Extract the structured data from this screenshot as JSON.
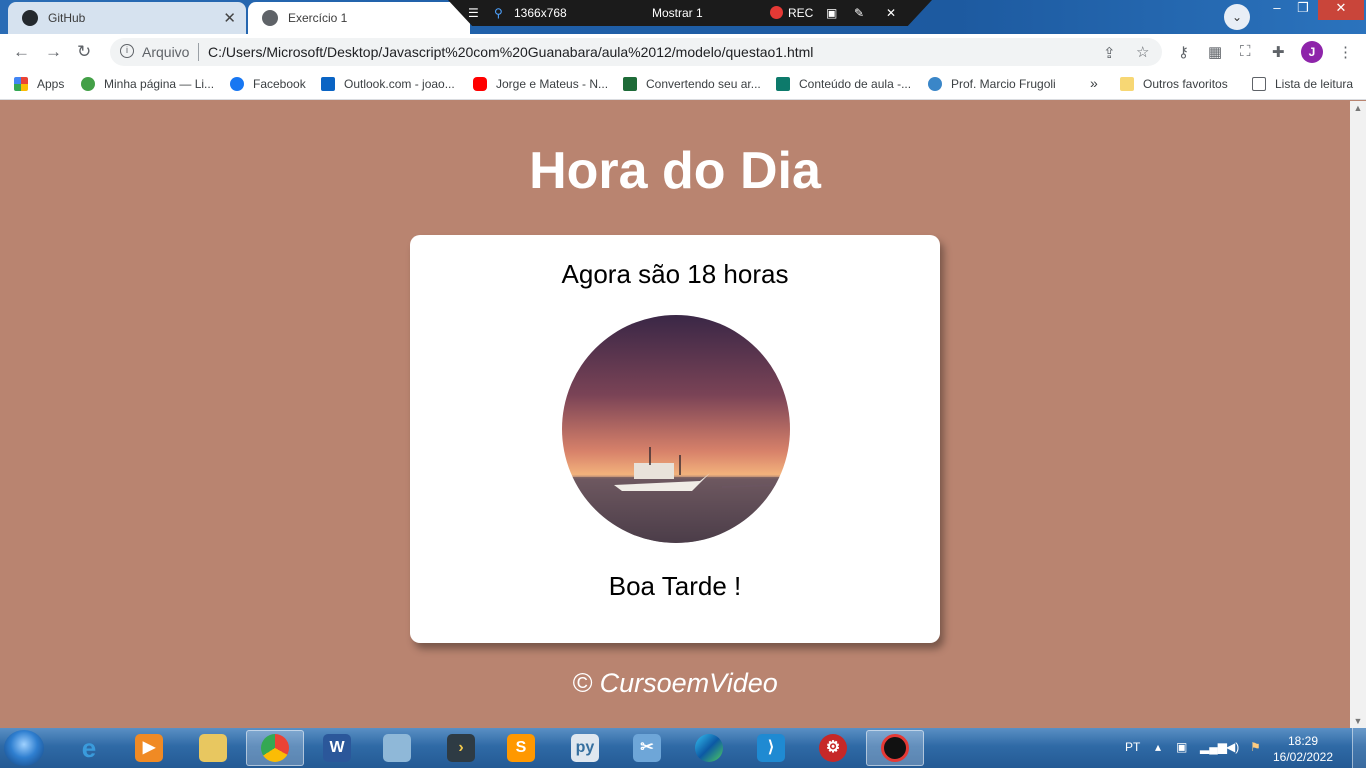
{
  "browser": {
    "tabs": [
      {
        "label": "GitHub"
      },
      {
        "label": "Exercício 1"
      }
    ],
    "recorder": {
      "resolution": "1366x768",
      "show_label": "Mostrar 1",
      "rec_label": "REC"
    },
    "address": {
      "security_label": "Arquivo",
      "url": "C:/Users/Microsoft/Desktop/Javascript%20com%20Guanabara/aula%2012/modelo/questao1.html"
    },
    "profile_initial": "J",
    "bookmarks": [
      {
        "label": "Apps"
      },
      {
        "label": "Minha página — Li..."
      },
      {
        "label": "Facebook"
      },
      {
        "label": "Outlook.com - joao..."
      },
      {
        "label": "Jorge e Mateus - N..."
      },
      {
        "label": "Convertendo seu ar..."
      },
      {
        "label": "Conteúdo de aula -..."
      },
      {
        "label": "Prof. Marcio Frugoli"
      }
    ],
    "other_bookmarks": "Outros favoritos",
    "reading_list": "Lista de leitura",
    "overflow": "»"
  },
  "page": {
    "title": "Hora do Dia",
    "message": "Agora são 18 horas",
    "greeting": "Boa Tarde !",
    "footer": "© CursoemVideo"
  },
  "taskbar": {
    "language": "PT",
    "time": "18:29",
    "date": "16/02/2022"
  },
  "colors": {
    "page_background": "#b98470",
    "card_background": "#ffffff",
    "chrome_frame": "#1f5fa8"
  }
}
